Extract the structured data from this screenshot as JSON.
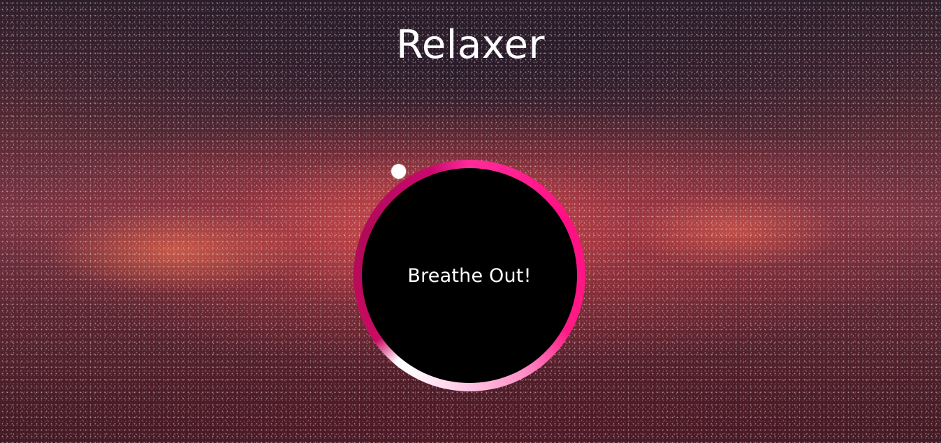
{
  "app": {
    "title": "Relaxer"
  },
  "breathing": {
    "instruction": "Breathe Out!"
  },
  "colors": {
    "ring_primary": "#ff0f84",
    "ring_secondary": "#b00a58",
    "ring_light": "#ffd6eb",
    "inner_circle": "#000000",
    "text": "#ffffff"
  },
  "icons": {
    "pointer": "dot-pointer-icon"
  }
}
